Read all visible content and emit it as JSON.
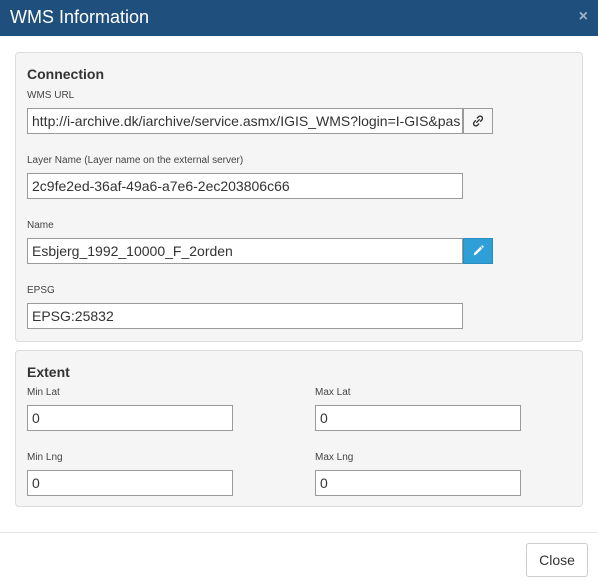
{
  "dialog": {
    "title": "WMS Information",
    "close_glyph": "×"
  },
  "connection": {
    "section_title": "Connection",
    "wms_url_label": "WMS URL",
    "wms_url_value": "http://i-archive.dk/iarchive/service.asmx/IGIS_WMS?login=I-GIS&pas",
    "link_icon": "link-icon",
    "layer_name_label": "Layer Name (Layer name on the external server)",
    "layer_name_value": "2c9fe2ed-36af-49a6-a7e6-2ec203806c66",
    "name_label": "Name",
    "name_value": "Esbjerg_1992_10000_F_2orden",
    "edit_icon": "pencil-icon",
    "epsg_label": "EPSG",
    "epsg_value": "EPSG:25832"
  },
  "extent": {
    "section_title": "Extent",
    "min_lat_label": "Min Lat",
    "min_lat_value": "0",
    "max_lat_label": "Max Lat",
    "max_lat_value": "0",
    "min_lng_label": "Min Lng",
    "min_lng_value": "0",
    "max_lng_label": "Max Lng",
    "max_lng_value": "0"
  },
  "footer": {
    "close_label": "Close"
  },
  "colors": {
    "titlebar": "#1f4f7c",
    "accent_button": "#2f9fd8",
    "panel_bg": "#f5f5f5"
  }
}
